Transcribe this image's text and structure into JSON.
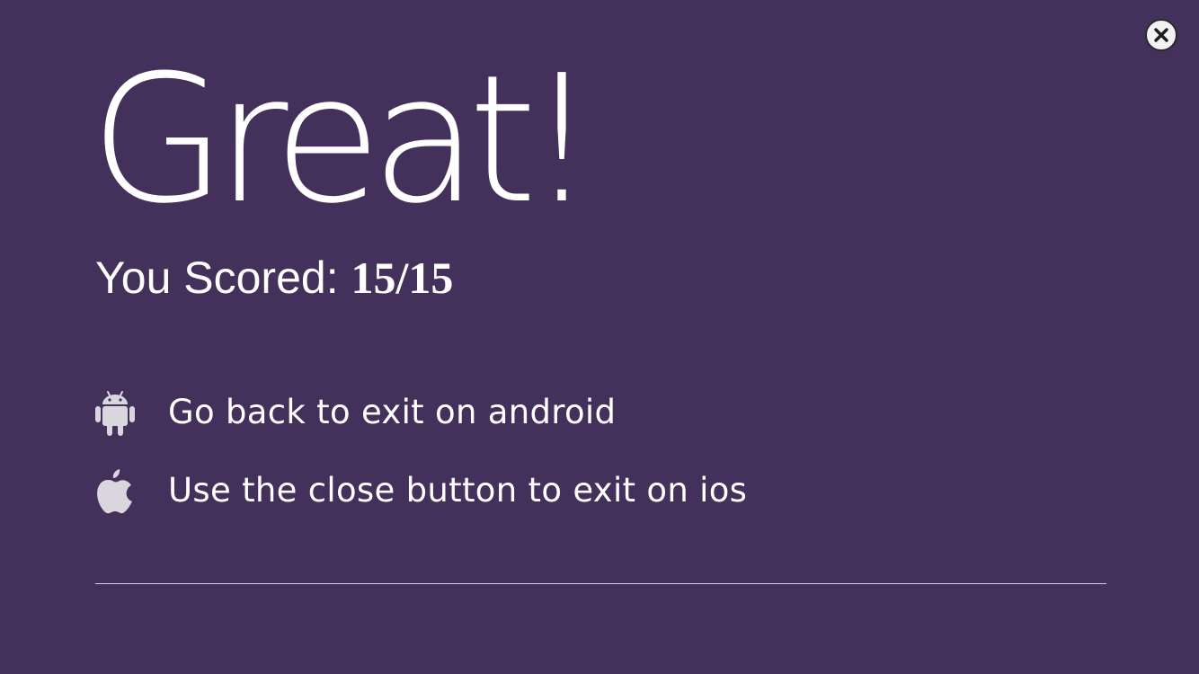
{
  "headline": "Great!",
  "score": {
    "label": "You Scored: ",
    "value": "15/15"
  },
  "instructions": [
    {
      "icon": "android-icon",
      "text": "Go back to exit on android"
    },
    {
      "icon": "apple-icon",
      "text": "Use the close button to exit on ios"
    }
  ],
  "close_button": {
    "icon": "close-icon"
  },
  "colors": {
    "background": "#43315c",
    "text": "#ffffff",
    "icon": "#d9d6dd",
    "close_button_fill": "#f2f2f2"
  }
}
